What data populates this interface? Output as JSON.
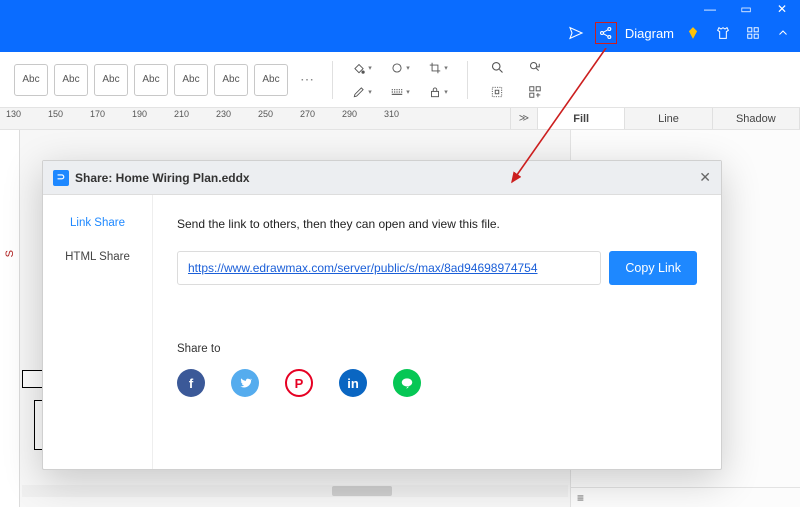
{
  "titlebar": {
    "app_label": "Diagram",
    "sys": {
      "min": "—",
      "max": "▭",
      "close": "✕"
    }
  },
  "abc": [
    "Abc",
    "Abc",
    "Abc",
    "Abc",
    "Abc",
    "Abc",
    "Abc"
  ],
  "ruler": [
    "130",
    "150",
    "170",
    "190",
    "210",
    "230",
    "250",
    "270",
    "290",
    "310"
  ],
  "side_tabs": {
    "collapse": "≫",
    "fill": "Fill",
    "line": "Line",
    "shadow": "Shadow"
  },
  "canvas": {
    "left_label": "S"
  },
  "panel_mini_icon": "≡",
  "dialog": {
    "title": "Share: Home Wiring Plan.eddx",
    "tabs": {
      "link": "Link Share",
      "html": "HTML Share"
    },
    "desc": "Send the link to others, then they can open and view this file.",
    "link": "https://www.edrawmax.com/server/public/s/max/8ad94698974754",
    "copy": "Copy Link",
    "share_to": "Share to",
    "social": {
      "fb": "f",
      "tw": "t",
      "pi": "P",
      "li": "in",
      "ln": "◎"
    },
    "close": "✕"
  }
}
